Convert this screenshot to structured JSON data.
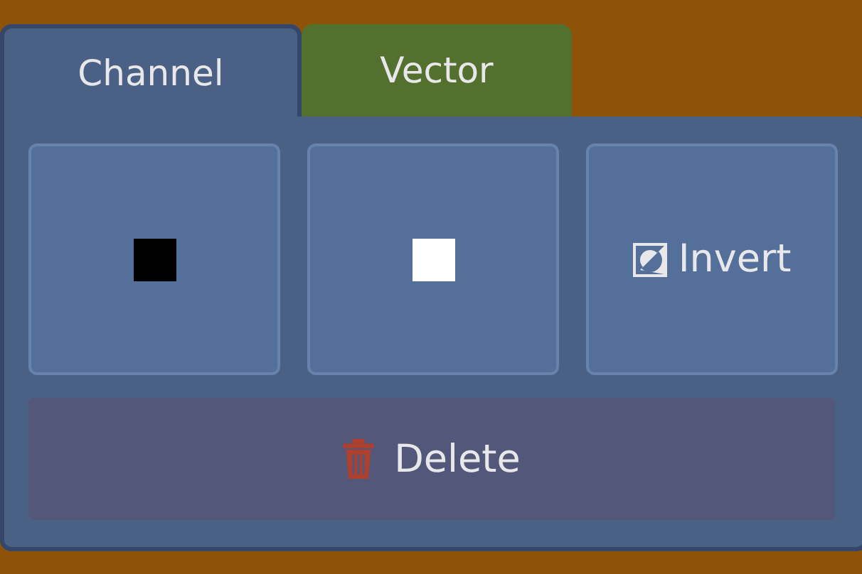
{
  "tabs": [
    {
      "label": "Channel",
      "selected": true
    },
    {
      "label": "Vector",
      "selected": false
    }
  ],
  "buttons": [
    {
      "kind": "black-swatch"
    },
    {
      "kind": "white-swatch"
    },
    {
      "kind": "invert",
      "label": "Invert"
    }
  ],
  "delete_button": {
    "label": "Delete"
  }
}
